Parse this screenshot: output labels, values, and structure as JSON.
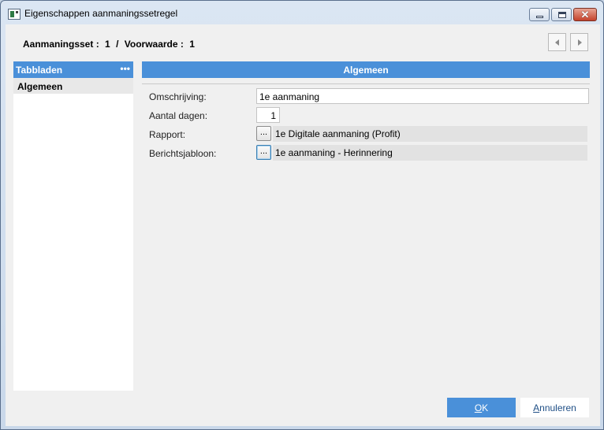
{
  "window": {
    "title": "Eigenschappen aanmaningssetregel",
    "close_glyph": "✕"
  },
  "header": {
    "set_label": "Aanmaningsset :",
    "set_value": "1",
    "separator": "/",
    "condition_label": "Voorwaarde :",
    "condition_value": "1"
  },
  "sidebar": {
    "title": "Tabbladen",
    "more_glyph": "•••",
    "items": [
      {
        "label": "Algemeen"
      }
    ]
  },
  "main": {
    "section_title": "Algemeen",
    "fields": {
      "omschrijving": {
        "label": "Omschrijving:",
        "value": "1e aanmaning"
      },
      "aantal_dagen": {
        "label": "Aantal dagen:",
        "value": "1"
      },
      "rapport": {
        "label": "Rapport:",
        "button": "...",
        "value": "1e Digitale aanmaning (Profit)"
      },
      "berichtsjabloon": {
        "label": "Berichtsjabloon:",
        "button": "...",
        "value": "1e aanmaning - Herinnering"
      }
    }
  },
  "footer": {
    "ok_mnemonic": "O",
    "ok_rest": "K",
    "cancel_mnemonic": "A",
    "cancel_rest": "nnuleren"
  },
  "colors": {
    "accent": "#4a90d9",
    "readonly_field": "#e2e2e2",
    "client_bg": "#f0f0f0"
  },
  "icons": [
    "app-icon",
    "minimize-icon",
    "maximize-icon",
    "close-icon",
    "more-icon",
    "chevron-left-icon",
    "chevron-right-icon"
  ]
}
